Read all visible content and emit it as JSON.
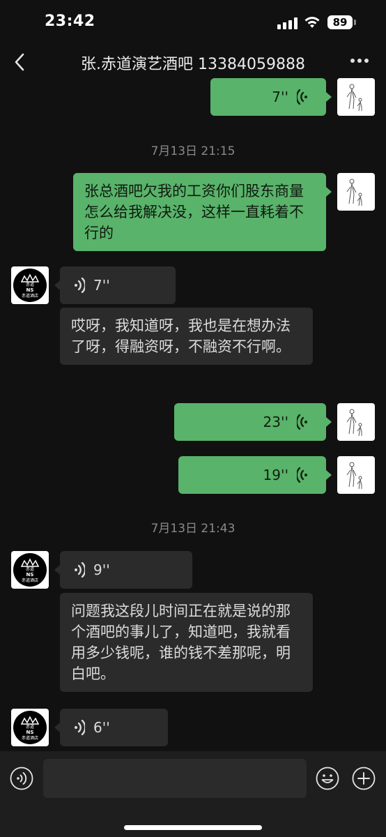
{
  "status_bar": {
    "time": "23:42",
    "battery": "89"
  },
  "header": {
    "title": "张.赤道演艺酒吧 13384059888"
  },
  "messages": {
    "m1_voice": "7''",
    "ts1": "7月13日 21:15",
    "m2_text": "张总酒吧欠我的工资你们股东商量怎么给我解决没，这样一直耗着不行的",
    "m3_voice": "7''",
    "m4_text": "哎呀，我知道呀，我也是在想办法了呀，得融资呀，不融资不行啊。",
    "m5_voice": "23''",
    "m6_voice": "19''",
    "ts2": "7月13日 21:43",
    "m7_voice": "9''",
    "m8_text": "问题我这段儿时间正在就是说的那个酒吧的事儿了，知道吧，我就看用多少钱呢，谁的钱不差那呢，明白吧。",
    "m9_voice": "6''"
  },
  "avatar_them_logo": {
    "line1": "赤道",
    "line2": "NS",
    "line3": "赤道酒店"
  },
  "colors": {
    "bubble_me": "#59b36a",
    "bubble_them": "#2b2b2b",
    "background": "#111111"
  }
}
